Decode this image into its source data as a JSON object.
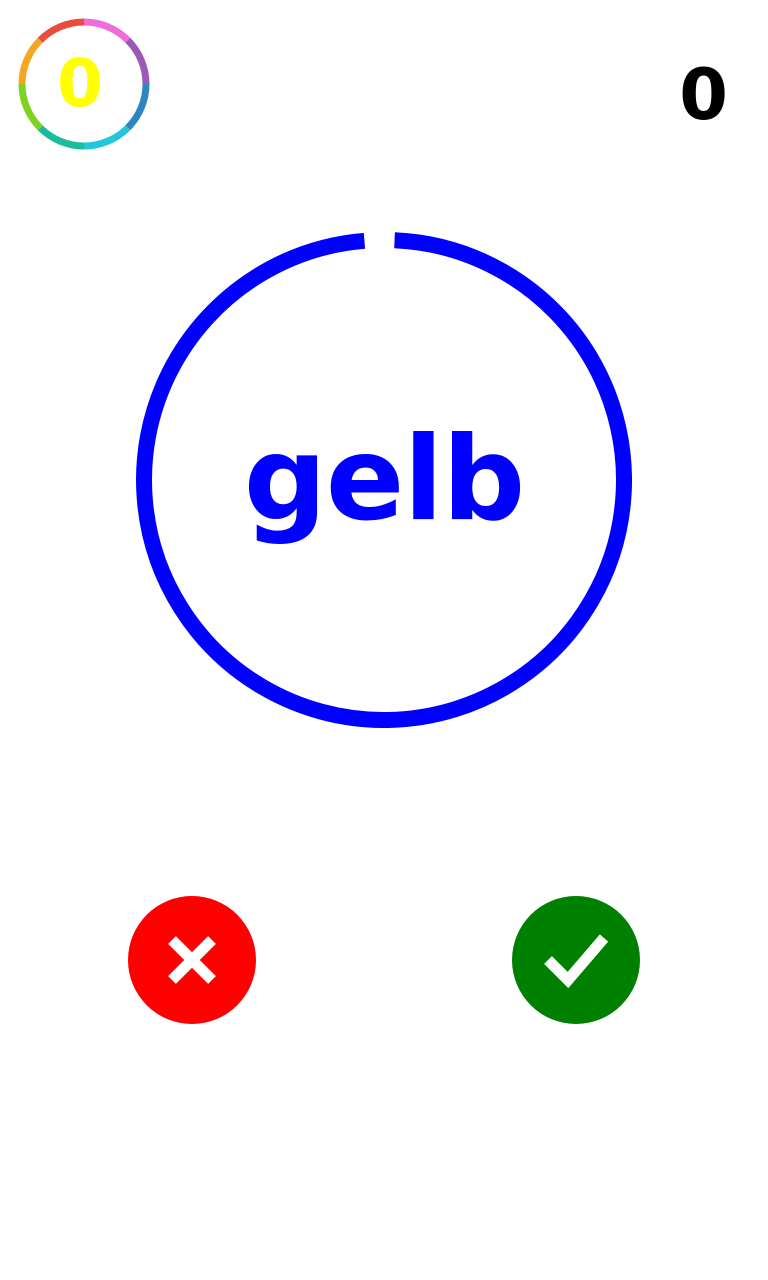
{
  "hud": {
    "streak_value": "0",
    "streak_color": "#ffff00",
    "score_value": "0"
  },
  "prompt": {
    "word": "gelb",
    "ink_color": "#0000ff"
  },
  "timer": {
    "remaining_fraction": 0.98
  },
  "buttons": {
    "wrong": {
      "icon": "close-icon",
      "color": "#ff0000"
    },
    "correct": {
      "icon": "check-icon",
      "color": "#008000"
    }
  },
  "colors": {
    "wrong": "#ff0000",
    "correct": "#008000",
    "ring": "#0000ff"
  }
}
